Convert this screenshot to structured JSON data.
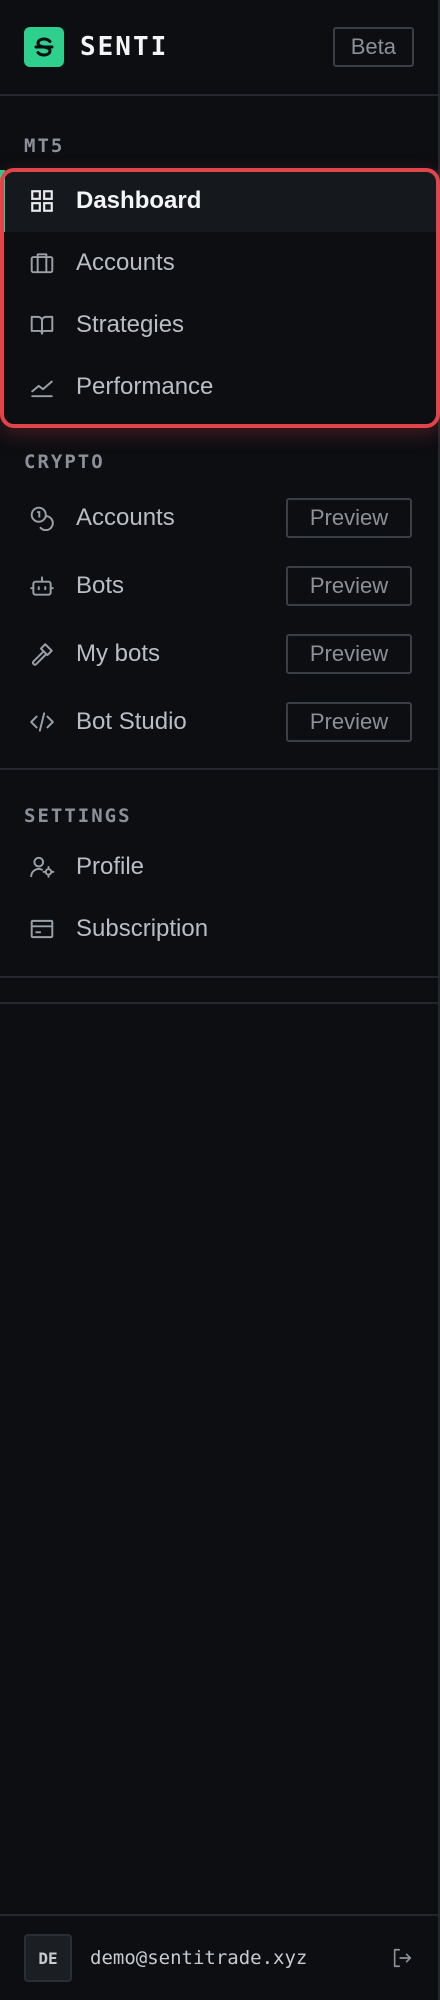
{
  "header": {
    "brand": "SENTI",
    "badge": "Beta"
  },
  "sections": {
    "mt5": {
      "title": "MT5",
      "items": [
        {
          "label": "Dashboard",
          "icon": "grid-icon",
          "active": true
        },
        {
          "label": "Accounts",
          "icon": "briefcase-icon"
        },
        {
          "label": "Strategies",
          "icon": "book-open-icon"
        },
        {
          "label": "Performance",
          "icon": "chart-line-icon"
        }
      ]
    },
    "crypto": {
      "title": "CRYPTO",
      "items": [
        {
          "label": "Accounts",
          "icon": "coins-icon",
          "tag": "Preview"
        },
        {
          "label": "Bots",
          "icon": "bot-icon",
          "tag": "Preview"
        },
        {
          "label": "My bots",
          "icon": "hammer-icon",
          "tag": "Preview"
        },
        {
          "label": "Bot Studio",
          "icon": "code-icon",
          "tag": "Preview"
        }
      ]
    },
    "settings": {
      "title": "SETTINGS",
      "items": [
        {
          "label": "Profile",
          "icon": "user-cog-icon"
        },
        {
          "label": "Subscription",
          "icon": "credit-card-icon"
        }
      ]
    }
  },
  "footer": {
    "avatar": "DE",
    "email": "demo@sentitrade.xyz"
  },
  "colors": {
    "accent": "#2fcf8e",
    "highlight": "#e0454a",
    "background": "#0d0e12"
  }
}
